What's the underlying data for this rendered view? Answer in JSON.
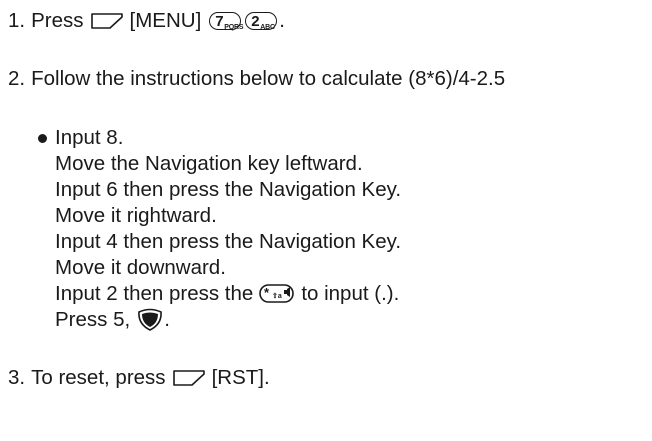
{
  "steps": [
    {
      "number": "1.",
      "text_before": "Press",
      "menu_label": "[MENU]",
      "key1": {
        "big": "7",
        "small": "PQRS"
      },
      "key2": {
        "big": "2",
        "small": "ABC"
      },
      "end": "."
    },
    {
      "number": "2.",
      "text": "Follow the instructions below to calculate (8*6)/4-2.5"
    },
    {
      "number": "3.",
      "text_before": "To reset, press",
      "rst_label": "[RST]."
    }
  ],
  "instructions": {
    "bullet_first": "Input 8.",
    "lines": [
      "Move the Navigation key leftward.",
      "Input 6 then press the Navigation Key.",
      "Move it rightward.",
      "Input 4 then press the Navigation Key.",
      "Move it downward."
    ],
    "star_line": {
      "before": "Input 2 then press the",
      "after": "to input (.)."
    },
    "final_line": {
      "before": "Press 5,",
      "after": "."
    }
  },
  "icons": {
    "soft_key": "soft-key-icon",
    "star_key": "star-key-icon",
    "ok_key": "navigation-ok-key-icon"
  }
}
